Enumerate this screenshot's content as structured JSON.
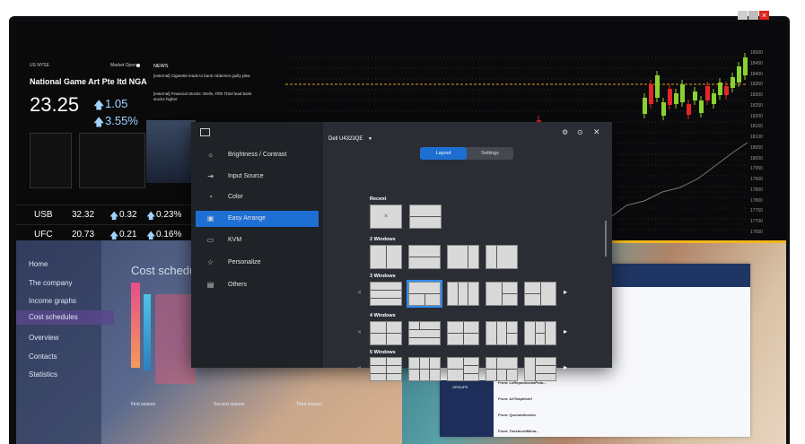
{
  "stock": {
    "exchange": "US NYSE",
    "market_status": "Market Open",
    "company": "National Game Art Pte ltd NGA",
    "price": "23.25",
    "change": "1.05",
    "change_pct": "3.55%",
    "news_title": "NEWS",
    "news": [
      "[external] Cigarette leads to bank robberies guilty plea",
      "[external] Financial Stocks: Wells, Fifth Third lead bank stocks higher"
    ],
    "tickers": [
      {
        "symbol": "USB",
        "price": "32.32",
        "change": "0.32",
        "pct": "0.23%"
      },
      {
        "symbol": "UFC",
        "price": "20.73",
        "change": "0.21",
        "pct": "0.16%"
      }
    ],
    "price_axis": [
      "18500",
      "18450",
      "18400",
      "18350",
      "18300",
      "18250",
      "18200",
      "18150",
      "18100",
      "18050",
      "18000",
      "17950",
      "17900",
      "17850",
      "17800",
      "17750",
      "17700",
      "17650"
    ]
  },
  "left_nav": {
    "items": [
      "Home",
      "The company",
      "Income graphs",
      "Cost schedules",
      "Overview",
      "Contacts",
      "Statistics"
    ],
    "selected": "Cost schedules",
    "heading": "Cost schedul",
    "seasons": [
      "First season",
      "Second season",
      "Third season"
    ]
  },
  "right_app": {
    "groups_label": "GROUPS",
    "messages": [
      "From: LoRepubicumaPota...",
      "From: AXTeaplefuhf",
      "From: Queramthovion",
      "From: TonsfuerdMinia..."
    ]
  },
  "dialog": {
    "monitor": "Dell U4323QE",
    "menu": [
      {
        "label": "Brightness / Contrast",
        "icon": "sun-icon"
      },
      {
        "label": "Input Source",
        "icon": "input-icon"
      },
      {
        "label": "Color",
        "icon": "color-icon"
      },
      {
        "label": "Easy Arrange",
        "icon": "arrange-icon"
      },
      {
        "label": "KVM",
        "icon": "kvm-icon"
      },
      {
        "label": "Personalize",
        "icon": "star-icon"
      },
      {
        "label": "Others",
        "icon": "others-icon"
      }
    ],
    "selected_menu": "Easy Arrange",
    "tabs": [
      "Layout",
      "Settings"
    ],
    "selected_tab": "Layout",
    "sections": [
      "Recent",
      "2 Windows",
      "3 Windows",
      "4 Windows",
      "5 Windows"
    ],
    "recent_clear": "×"
  }
}
